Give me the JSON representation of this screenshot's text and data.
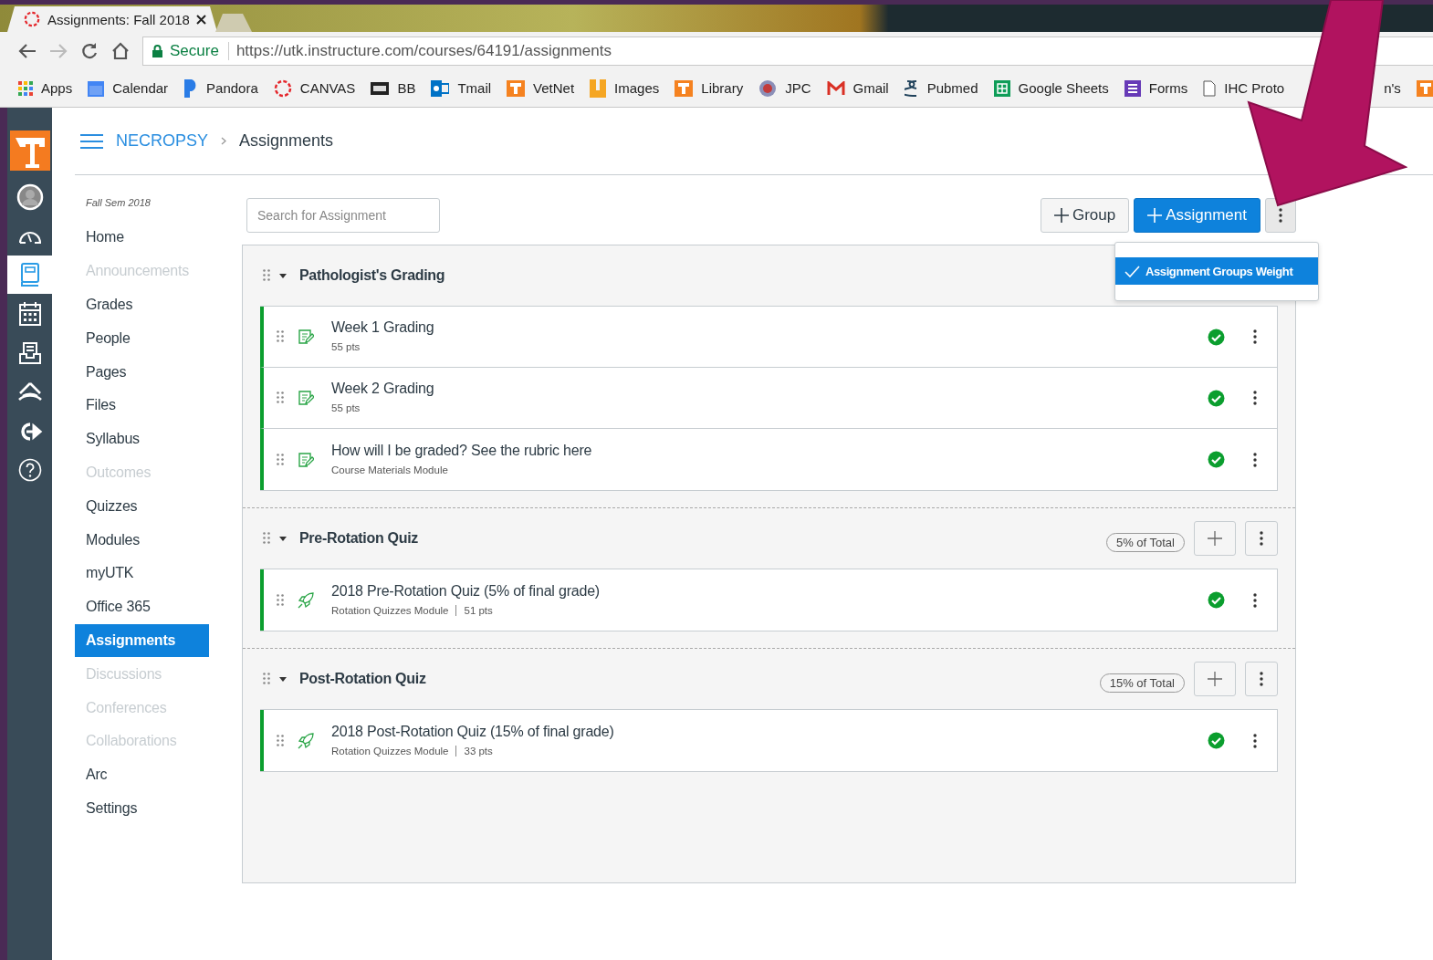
{
  "browser": {
    "tab_title": "Assignments: Fall 2018",
    "secure_label": "Secure",
    "url": "https://utk.instructure.com/courses/64191/assignments"
  },
  "bookmarks": [
    {
      "label": "Apps",
      "kind": "apps"
    },
    {
      "label": "Calendar",
      "kind": "calendar"
    },
    {
      "label": "Pandora",
      "kind": "pandora"
    },
    {
      "label": "CANVAS",
      "kind": "canvas"
    },
    {
      "label": "BB",
      "kind": "bb"
    },
    {
      "label": "Tmail",
      "kind": "mail"
    },
    {
      "label": "VetNet",
      "kind": "orange"
    },
    {
      "label": "Images",
      "kind": "amber"
    },
    {
      "label": "Library",
      "kind": "orange"
    },
    {
      "label": "JPC",
      "kind": "seal"
    },
    {
      "label": "Gmail",
      "kind": "gmail"
    },
    {
      "label": "Pubmed",
      "kind": "pubmed"
    },
    {
      "label": "Google Sheets",
      "kind": "sheets"
    },
    {
      "label": "Forms",
      "kind": "forms"
    },
    {
      "label": "IHC Proto",
      "kind": "page"
    },
    {
      "label": "n's",
      "kind": "none"
    },
    {
      "kind": "orange"
    }
  ],
  "global_nav": [
    {
      "kind": "logo",
      "selected": false
    },
    {
      "kind": "account",
      "selected": false
    },
    {
      "kind": "dashboard",
      "selected": false
    },
    {
      "kind": "courses",
      "selected": true
    },
    {
      "kind": "calendar",
      "selected": false
    },
    {
      "kind": "inbox",
      "selected": false
    },
    {
      "kind": "commons",
      "selected": false
    },
    {
      "kind": "logout",
      "selected": false
    },
    {
      "kind": "help",
      "selected": false
    }
  ],
  "breadcrumb": {
    "course": "NECROPSY",
    "page": "Assignments"
  },
  "course_nav": {
    "term": "Fall Sem 2018",
    "items": [
      {
        "label": "Home",
        "disabled": false,
        "selected": false
      },
      {
        "label": "Announcements",
        "disabled": true,
        "selected": false
      },
      {
        "label": "Grades",
        "disabled": false,
        "selected": false
      },
      {
        "label": "People",
        "disabled": false,
        "selected": false
      },
      {
        "label": "Pages",
        "disabled": false,
        "selected": false
      },
      {
        "label": "Files",
        "disabled": false,
        "selected": false
      },
      {
        "label": "Syllabus",
        "disabled": false,
        "selected": false
      },
      {
        "label": "Outcomes",
        "disabled": true,
        "selected": false
      },
      {
        "label": "Quizzes",
        "disabled": false,
        "selected": false
      },
      {
        "label": "Modules",
        "disabled": false,
        "selected": false
      },
      {
        "label": "myUTK",
        "disabled": false,
        "selected": false
      },
      {
        "label": "Office 365",
        "disabled": false,
        "selected": false
      },
      {
        "label": "Assignments",
        "disabled": false,
        "selected": true
      },
      {
        "label": "Discussions",
        "disabled": true,
        "selected": false
      },
      {
        "label": "Conferences",
        "disabled": true,
        "selected": false
      },
      {
        "label": "Collaborations",
        "disabled": true,
        "selected": false
      },
      {
        "label": "Arc",
        "disabled": false,
        "selected": false
      },
      {
        "label": "Settings",
        "disabled": false,
        "selected": false
      }
    ]
  },
  "toolbar": {
    "search_placeholder": "Search for Assignment",
    "buttons": [
      {
        "label": "Group",
        "kind": "secondary"
      },
      {
        "label": "Assignment",
        "kind": "primary"
      }
    ]
  },
  "settings_menu": {
    "items": [
      {
        "label": "Assignment Groups Weight",
        "checked": true,
        "selected": true
      }
    ]
  },
  "groups": [
    {
      "name": "Pathologist's Grading",
      "expanded": true,
      "items": [
        {
          "title": "Week 1 Grading",
          "meta": "55 pts",
          "kind": "assignment",
          "published": true
        },
        {
          "title": "Week 2 Grading",
          "meta": "55 pts",
          "kind": "assignment",
          "published": true
        },
        {
          "title": "How will I be graded? See the rubric here",
          "meta": "Course Materials Module",
          "kind": "assignment",
          "published": true
        }
      ]
    },
    {
      "name": "Pre-Rotation Quiz",
      "expanded": true,
      "weight": "5% of Total",
      "items": [
        {
          "title": "2018 Pre-Rotation Quiz (5% of final grade)",
          "meta": "Rotation Quizzes Module",
          "points": "51 pts",
          "kind": "quiz",
          "published": true
        }
      ]
    },
    {
      "name": "Post-Rotation Quiz",
      "expanded": true,
      "weight": "15% of Total",
      "items": [
        {
          "title": "2018 Post-Rotation Quiz (15% of final grade)",
          "meta": "Rotation Quizzes Module",
          "points": "33 pts",
          "kind": "quiz",
          "published": true
        }
      ]
    }
  ]
}
